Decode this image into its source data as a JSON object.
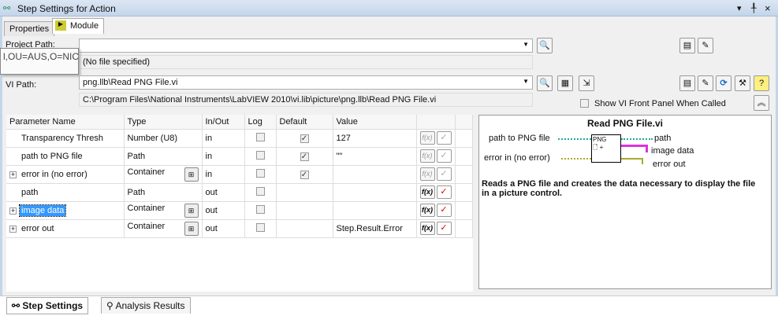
{
  "window": {
    "title": "Step Settings for Action",
    "controls": [
      "▾",
      "╀",
      "×"
    ]
  },
  "tabs": {
    "properties": "Properties",
    "module": "Module"
  },
  "tooltip": "l,OU=AUS,O=NIC",
  "project": {
    "label": "Project Path:",
    "value": "",
    "status": "(No file specified)"
  },
  "vi": {
    "label": "VI Path:",
    "value": "png.llb\\Read PNG File.vi",
    "full_path": "C:\\Program Files\\National Instruments\\LabVIEW 2010\\vi.lib\\picture\\png.llb\\Read PNG File.vi",
    "show_panel": "Show VI Front Panel When Called"
  },
  "table": {
    "headers": [
      "Parameter Name",
      "Type",
      "In/Out",
      "Log",
      "Default",
      "Value"
    ],
    "rows": [
      {
        "name": "Transparency Thresh",
        "type": "Number (U8)",
        "io": "in",
        "default": true,
        "value": "127",
        "expand": false,
        "tree": false,
        "active": false
      },
      {
        "name": "path to PNG file",
        "type": "Path",
        "io": "in",
        "default": true,
        "value": "\"\"",
        "expand": false,
        "tree": false,
        "active": false
      },
      {
        "name": "error in (no error)",
        "type": "Container",
        "io": "in",
        "default": true,
        "value": "",
        "expand": true,
        "tree": true,
        "active": false
      },
      {
        "name": "path",
        "type": "Path",
        "io": "out",
        "default": null,
        "value": "",
        "expand": false,
        "tree": false,
        "active": true
      },
      {
        "name": "image data",
        "type": "Container",
        "io": "out",
        "default": null,
        "value": "",
        "expand": true,
        "tree": true,
        "active": true,
        "selected": true
      },
      {
        "name": "error out",
        "type": "Container",
        "io": "out",
        "default": null,
        "value": "Step.Result.Error",
        "expand": true,
        "tree": true,
        "active": true
      }
    ]
  },
  "help": {
    "title": "Read PNG File.vi",
    "inputs": [
      "path to PNG file",
      "error in (no error)"
    ],
    "outputs": [
      "path",
      "image data",
      "error out"
    ],
    "icon_text": "PNG",
    "description": "Reads a PNG file and creates the data necessary to display the file in a picture control."
  },
  "bottom_tabs": {
    "step_settings": "Step Settings",
    "analysis": "Analysis Results"
  }
}
